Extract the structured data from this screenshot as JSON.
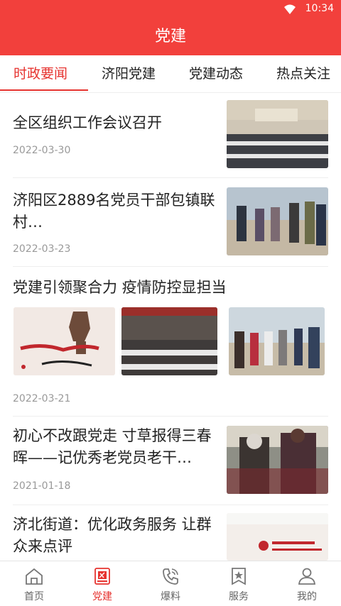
{
  "status": {
    "time": "10:34"
  },
  "header": {
    "title": "党建"
  },
  "tabs": [
    {
      "label": "时政要闻"
    },
    {
      "label": "济阳党建"
    },
    {
      "label": "党建动态"
    },
    {
      "label": "热点关注"
    }
  ],
  "articles": [
    {
      "title": "全区组织工作会议召开",
      "date": "2022-03-30"
    },
    {
      "title": "济阳区2889名党员干部包镇联村…",
      "date": "2022-03-23"
    },
    {
      "title": "党建引领聚合力 疫情防控显担当",
      "date": "2022-03-21"
    },
    {
      "title": "初心不改跟党走 寸草报得三春晖——记优秀老党员老干…",
      "date": "2021-01-18"
    },
    {
      "title": "济北街道：优化政务服务 让群众来点评"
    }
  ],
  "tabbar": [
    {
      "label": "首页",
      "icon": "home-icon"
    },
    {
      "label": "党建",
      "icon": "party-icon"
    },
    {
      "label": "爆料",
      "icon": "phone-icon"
    },
    {
      "label": "服务",
      "icon": "star-book-icon"
    },
    {
      "label": "我的",
      "icon": "user-icon"
    }
  ],
  "colors": {
    "brand": "#f2403c",
    "active": "#e6332f"
  }
}
